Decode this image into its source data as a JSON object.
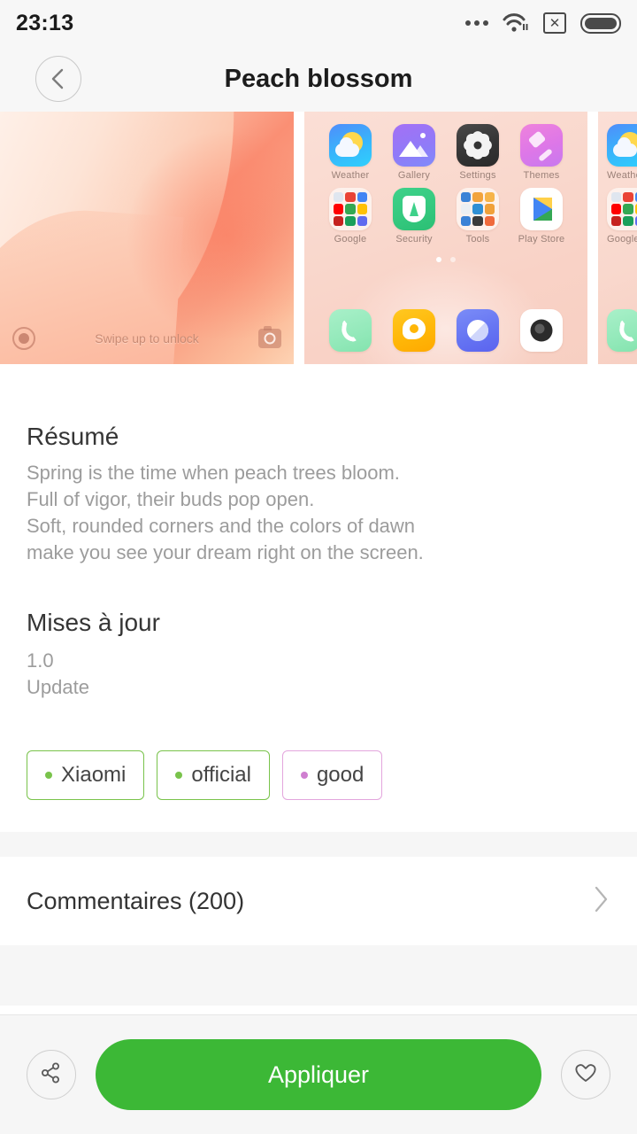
{
  "status_bar": {
    "time": "23:13",
    "icons": [
      "more-dots-icon",
      "wifi-icon",
      "sim-x-icon",
      "battery-icon"
    ],
    "sim_glyph": "✕"
  },
  "app_bar": {
    "title": "Peach blossom",
    "back_icon": "chevron-left-icon"
  },
  "previews": {
    "lockscreen": {
      "hint": "Swipe up to unlock",
      "left_icon": "unlock-circle-icon",
      "right_icon": "camera-icon"
    },
    "homescreen": {
      "apps": [
        {
          "label": "Weather",
          "icon": "weather-icon"
        },
        {
          "label": "Gallery",
          "icon": "gallery-icon"
        },
        {
          "label": "Settings",
          "icon": "settings-icon"
        },
        {
          "label": "Themes",
          "icon": "themes-icon"
        },
        {
          "label": "Google",
          "icon": "google-folder-icon"
        },
        {
          "label": "Security",
          "icon": "security-icon"
        },
        {
          "label": "Tools",
          "icon": "tools-folder-icon"
        },
        {
          "label": "Play Store",
          "icon": "play-store-icon"
        }
      ],
      "dock": [
        {
          "label": "Phone",
          "icon": "phone-icon"
        },
        {
          "label": "Messages",
          "icon": "messages-icon"
        },
        {
          "label": "Browser",
          "icon": "browser-icon"
        },
        {
          "label": "Camera",
          "icon": "camera-icon"
        }
      ],
      "pages": 2,
      "active_page": 1
    }
  },
  "summary": {
    "heading": "Résumé",
    "text": "Spring is the time when peach trees bloom.\nFull of vigor, their buds pop open.\nSoft, rounded corners and the colors of dawn\nmake you see your dream right on the screen."
  },
  "updates": {
    "heading": "Mises à jour",
    "version": "1.0",
    "note": "Update"
  },
  "tags": [
    {
      "label": "Xiaomi",
      "color": "#79c34b"
    },
    {
      "label": "official",
      "color": "#79c34b"
    },
    {
      "label": "good",
      "color": "#cf7fd0"
    }
  ],
  "comments": {
    "label": "Commentaires (200)",
    "chevron_icon": "chevron-right-icon"
  },
  "bottom_bar": {
    "share_icon": "share-icon",
    "apply_label": "Appliquer",
    "apply_color": "#3cb836",
    "favorite_icon": "heart-icon"
  }
}
